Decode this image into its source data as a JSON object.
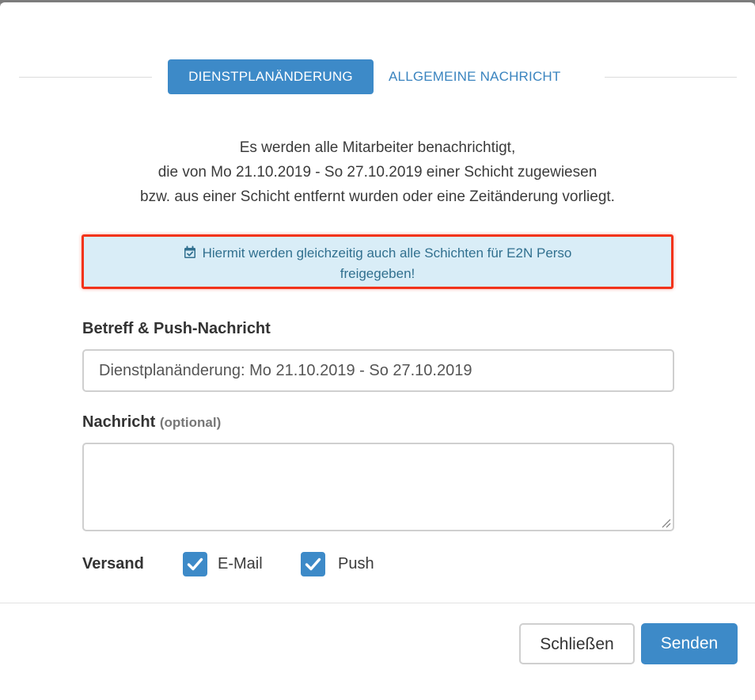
{
  "tabs": {
    "active_label": "DIENSTPLANÄNDERUNG",
    "inactive_label": "ALLGEMEINE NACHRICHT"
  },
  "intro": {
    "line1": "Es werden alle Mitarbeiter benachrichtigt,",
    "line2": "die von Mo 21.10.2019 - So 27.10.2019 einer Schicht zugewiesen",
    "line3": "bzw. aus einer Schicht entfernt wurden oder eine Zeitänderung vorliegt."
  },
  "alert": {
    "icon": "calendar-check-icon",
    "line1": "Hiermit werden gleichzeitig auch alle Schichten für E2N Perso",
    "line2": "freigegeben!",
    "highlight_color": "#f2331a"
  },
  "subject": {
    "label": "Betreff & Push-Nachricht",
    "value": "Dienstplanänderung: Mo 21.10.2019 - So 27.10.2019"
  },
  "message": {
    "label": "Nachricht",
    "optional_label": "(optional)",
    "value": ""
  },
  "delivery": {
    "label": "Versand",
    "options": [
      {
        "label": "E-Mail",
        "checked": true
      },
      {
        "label": "Push",
        "checked": true
      }
    ]
  },
  "footer": {
    "close_label": "Schließen",
    "send_label": "Senden"
  },
  "colors": {
    "primary": "#3d8ac8",
    "alert_bg": "#d9edf7",
    "alert_text": "#31708f"
  }
}
